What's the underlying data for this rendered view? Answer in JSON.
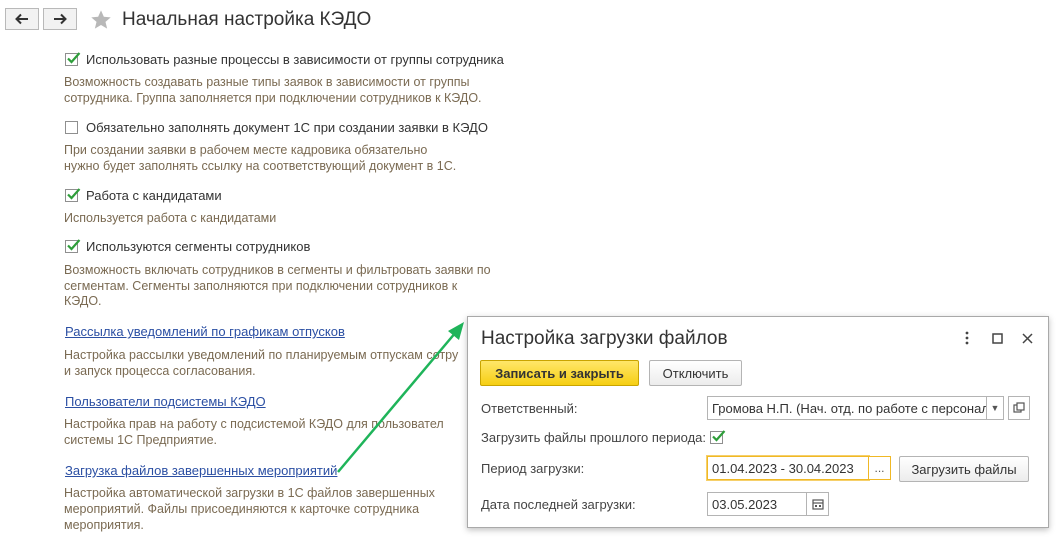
{
  "header": {
    "title": "Начальная настройка КЭДО",
    "back_icon": "arrow-left-icon",
    "forward_icon": "arrow-right-icon",
    "favorite_icon": "star-icon"
  },
  "settings": {
    "options": [
      {
        "label": "Использовать разные процессы в зависимости от группы сотрудника",
        "checked": true,
        "desc": [
          "Возможность создавать разные типы заявок в зависимости от группы",
          "сотрудника. Группа заполняется при подключении сотрудников к КЭДО."
        ]
      },
      {
        "label": "Обязательно заполнять документ 1С при создании заявки в КЭДО",
        "checked": false,
        "desc": [
          "При создании заявки в рабочем месте кадровика обязательно",
          "нужно будет заполнять ссылку на соответствующий документ в 1С."
        ]
      },
      {
        "label": "Работа с кандидатами",
        "checked": true,
        "desc": [
          "Используется работа с кандидатами"
        ]
      },
      {
        "label": "Используются сегменты сотрудников",
        "checked": true,
        "desc": [
          "Возможность включать сотрудников в сегменты и фильтровать заявки по",
          "сегментам. Сегменты заполняются при подключении сотрудников к",
          "КЭДО."
        ]
      }
    ],
    "links": [
      {
        "label": "Рассылка уведомлений по графикам отпусков",
        "desc": [
          "Настройка рассылки уведомлений по планируемым отпускам сотру",
          "и запуск процесса согласования."
        ]
      },
      {
        "label": "Пользователи подсистемы КЭДО",
        "desc": [
          "Настройка прав на работу с подсистемой КЭДО для пользовател",
          "системы 1С Предприятие."
        ]
      },
      {
        "label": "Загрузка файлов завершенных мероприятий",
        "desc": [
          "Настройка автоматической загрузки в 1С файлов завершенных",
          "мероприятий. Файлы присоединяются к карточке сотрудника",
          "мероприятия."
        ]
      }
    ]
  },
  "dialog": {
    "title": "Настройка загрузки файлов",
    "save_close_label": "Записать и закрыть",
    "disable_label": "Отключить",
    "responsible_label": "Ответственный:",
    "responsible_value": "Громова Н.П. (Нач. отд. по работе с персонал",
    "load_past_label": "Загрузить файлы прошлого периода:",
    "load_past_checked": true,
    "period_label": "Период загрузки:",
    "period_value": "01.04.2023 - 30.04.2023",
    "period_button": "...",
    "load_files_label": "Загрузить файлы",
    "last_load_label": "Дата последней загрузки:",
    "last_load_value": "03.05.2023"
  },
  "colors": {
    "accent_yellow": "#f6cf13",
    "check_green": "#2e9e3a",
    "link_blue": "#2b4fa3",
    "arrow_green": "#1fb45a",
    "desc_text": "#7a6a52"
  }
}
